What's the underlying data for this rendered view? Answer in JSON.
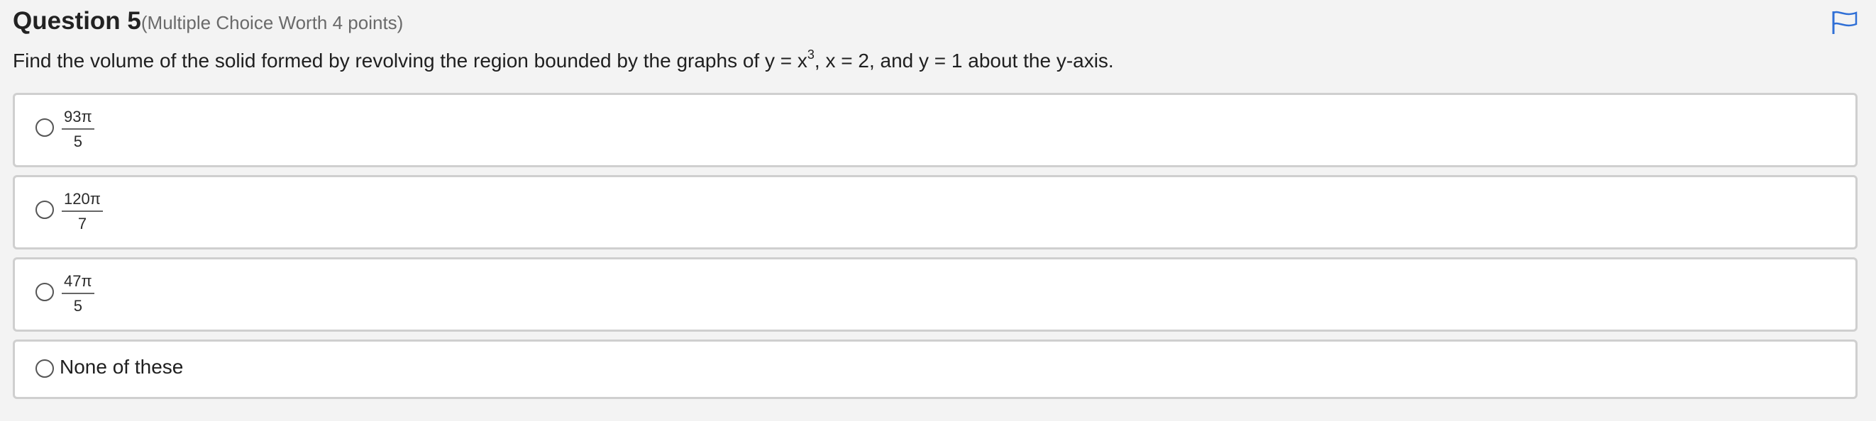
{
  "question": {
    "title": "Question 5",
    "meta": "(Multiple Choice Worth 4 points)",
    "text_before": "Find the volume of the solid formed by revolving the region bounded by the graphs of y = x",
    "exponent": "3",
    "text_after": ", x = 2, and y = 1 about the y-axis."
  },
  "flag_icon": "flag-icon",
  "accent_color": "#2f6fd6",
  "options": [
    {
      "numerator": "93π",
      "denominator": "5"
    },
    {
      "numerator": "120π",
      "denominator": "7"
    },
    {
      "numerator": "47π",
      "denominator": "5"
    },
    {
      "label": "None of these"
    }
  ]
}
